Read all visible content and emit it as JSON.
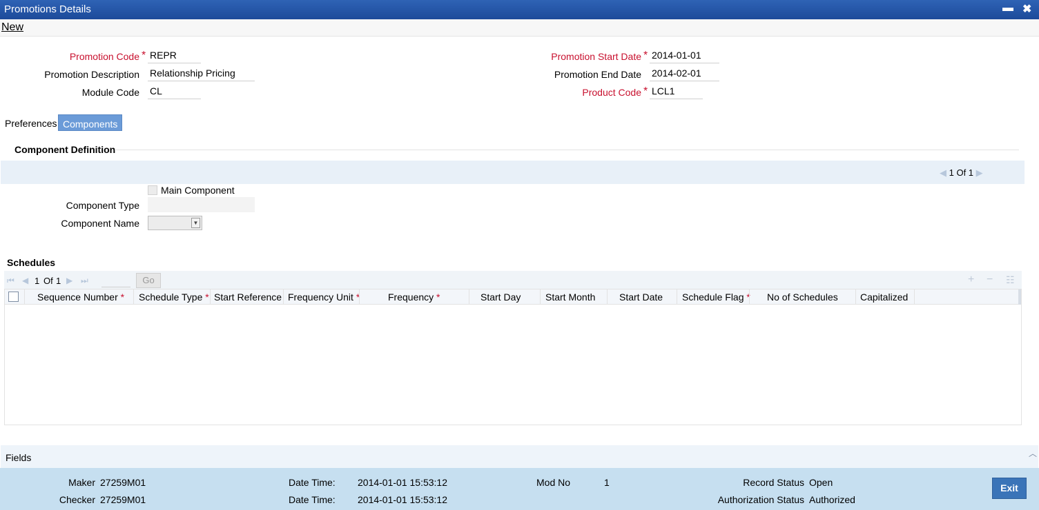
{
  "window": {
    "title": "Promotions Details",
    "minimize": "▬",
    "close": "✖"
  },
  "menu": {
    "new_label": "New"
  },
  "form": {
    "promotion_code_label": "Promotion Code",
    "promotion_code_value": "REPR",
    "promotion_description_label": "Promotion Description",
    "promotion_description_value": "Relationship Pricing",
    "module_code_label": "Module Code",
    "module_code_value": "CL",
    "promotion_start_date_label": "Promotion Start Date",
    "promotion_start_date_value": "2014-01-01",
    "promotion_end_date_label": "Promotion End Date",
    "promotion_end_date_value": "2014-02-01",
    "product_code_label": "Product Code",
    "product_code_value": "LCL1",
    "required_marker": "*"
  },
  "tabs": [
    {
      "label": "Preferences",
      "active": false
    },
    {
      "label": "Components",
      "active": true
    }
  ],
  "component_definition": {
    "title": "Component Definition",
    "pager": "1 Of 1",
    "main_component_label": "Main Component",
    "main_component_checked": false,
    "component_type_label": "Component Type",
    "component_type_value": "",
    "component_name_label": "Component Name",
    "component_name_value": ""
  },
  "schedules": {
    "title": "Schedules",
    "pager_current": "1",
    "pager_of": "Of",
    "pager_total": "1",
    "go_label": "Go",
    "columns": [
      {
        "label": "Sequence Number",
        "required": true
      },
      {
        "label": "Schedule Type",
        "required": true
      },
      {
        "label": "Start Reference",
        "required": false
      },
      {
        "label": "Frequency Unit",
        "required": true
      },
      {
        "label": "Frequency",
        "required": true
      },
      {
        "label": "Start Day",
        "required": false
      },
      {
        "label": "Start Month",
        "required": false
      },
      {
        "label": "Start Date",
        "required": false
      },
      {
        "label": "Schedule Flag",
        "required": true
      },
      {
        "label": "No of Schedules",
        "required": false
      },
      {
        "label": "Capitalized",
        "required": false
      }
    ],
    "rows": []
  },
  "fields_label": "Fields",
  "footer": {
    "maker_label": "Maker",
    "maker_value": "27259M01",
    "checker_label": "Checker",
    "checker_value": "27259M01",
    "date_time_label": "Date Time:",
    "maker_date_time": "2014-01-01 15:53:12",
    "checker_date_time": "2014-01-01 15:53:12",
    "mod_no_label": "Mod No",
    "mod_no_value": "1",
    "record_status_label": "Record Status",
    "record_status_value": "Open",
    "authorization_status_label": "Authorization Status",
    "authorization_status_value": "Authorized",
    "exit_label": "Exit"
  },
  "colors": {
    "titlebar": "#1c4a9a",
    "required": "#c8102e",
    "active_tab": "#6b9bd8",
    "footer": "#c6dff0",
    "exit_button": "#3a74b8"
  }
}
